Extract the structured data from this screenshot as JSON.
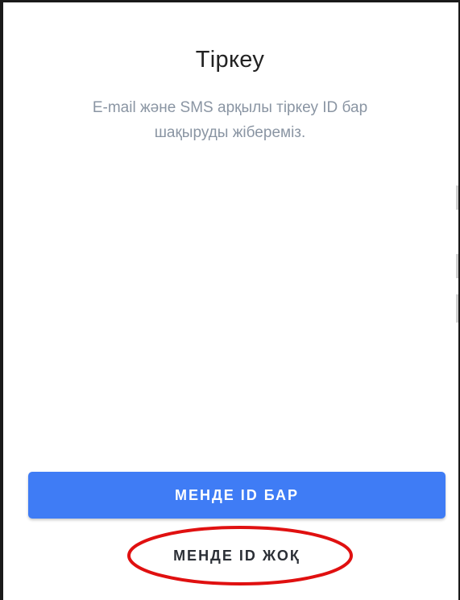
{
  "header": {
    "title": "Тіркеу",
    "subtitle": "E-mail және SMS арқылы тіркеу ID бар шақыруды жібереміз."
  },
  "actions": {
    "primary_label": "МЕНДЕ ID БАР",
    "secondary_label": "МЕНДЕ ID ЖОҚ"
  },
  "colors": {
    "primary": "#3f7cf5",
    "highlight": "#e01010",
    "subtitle": "#8a95a3"
  }
}
